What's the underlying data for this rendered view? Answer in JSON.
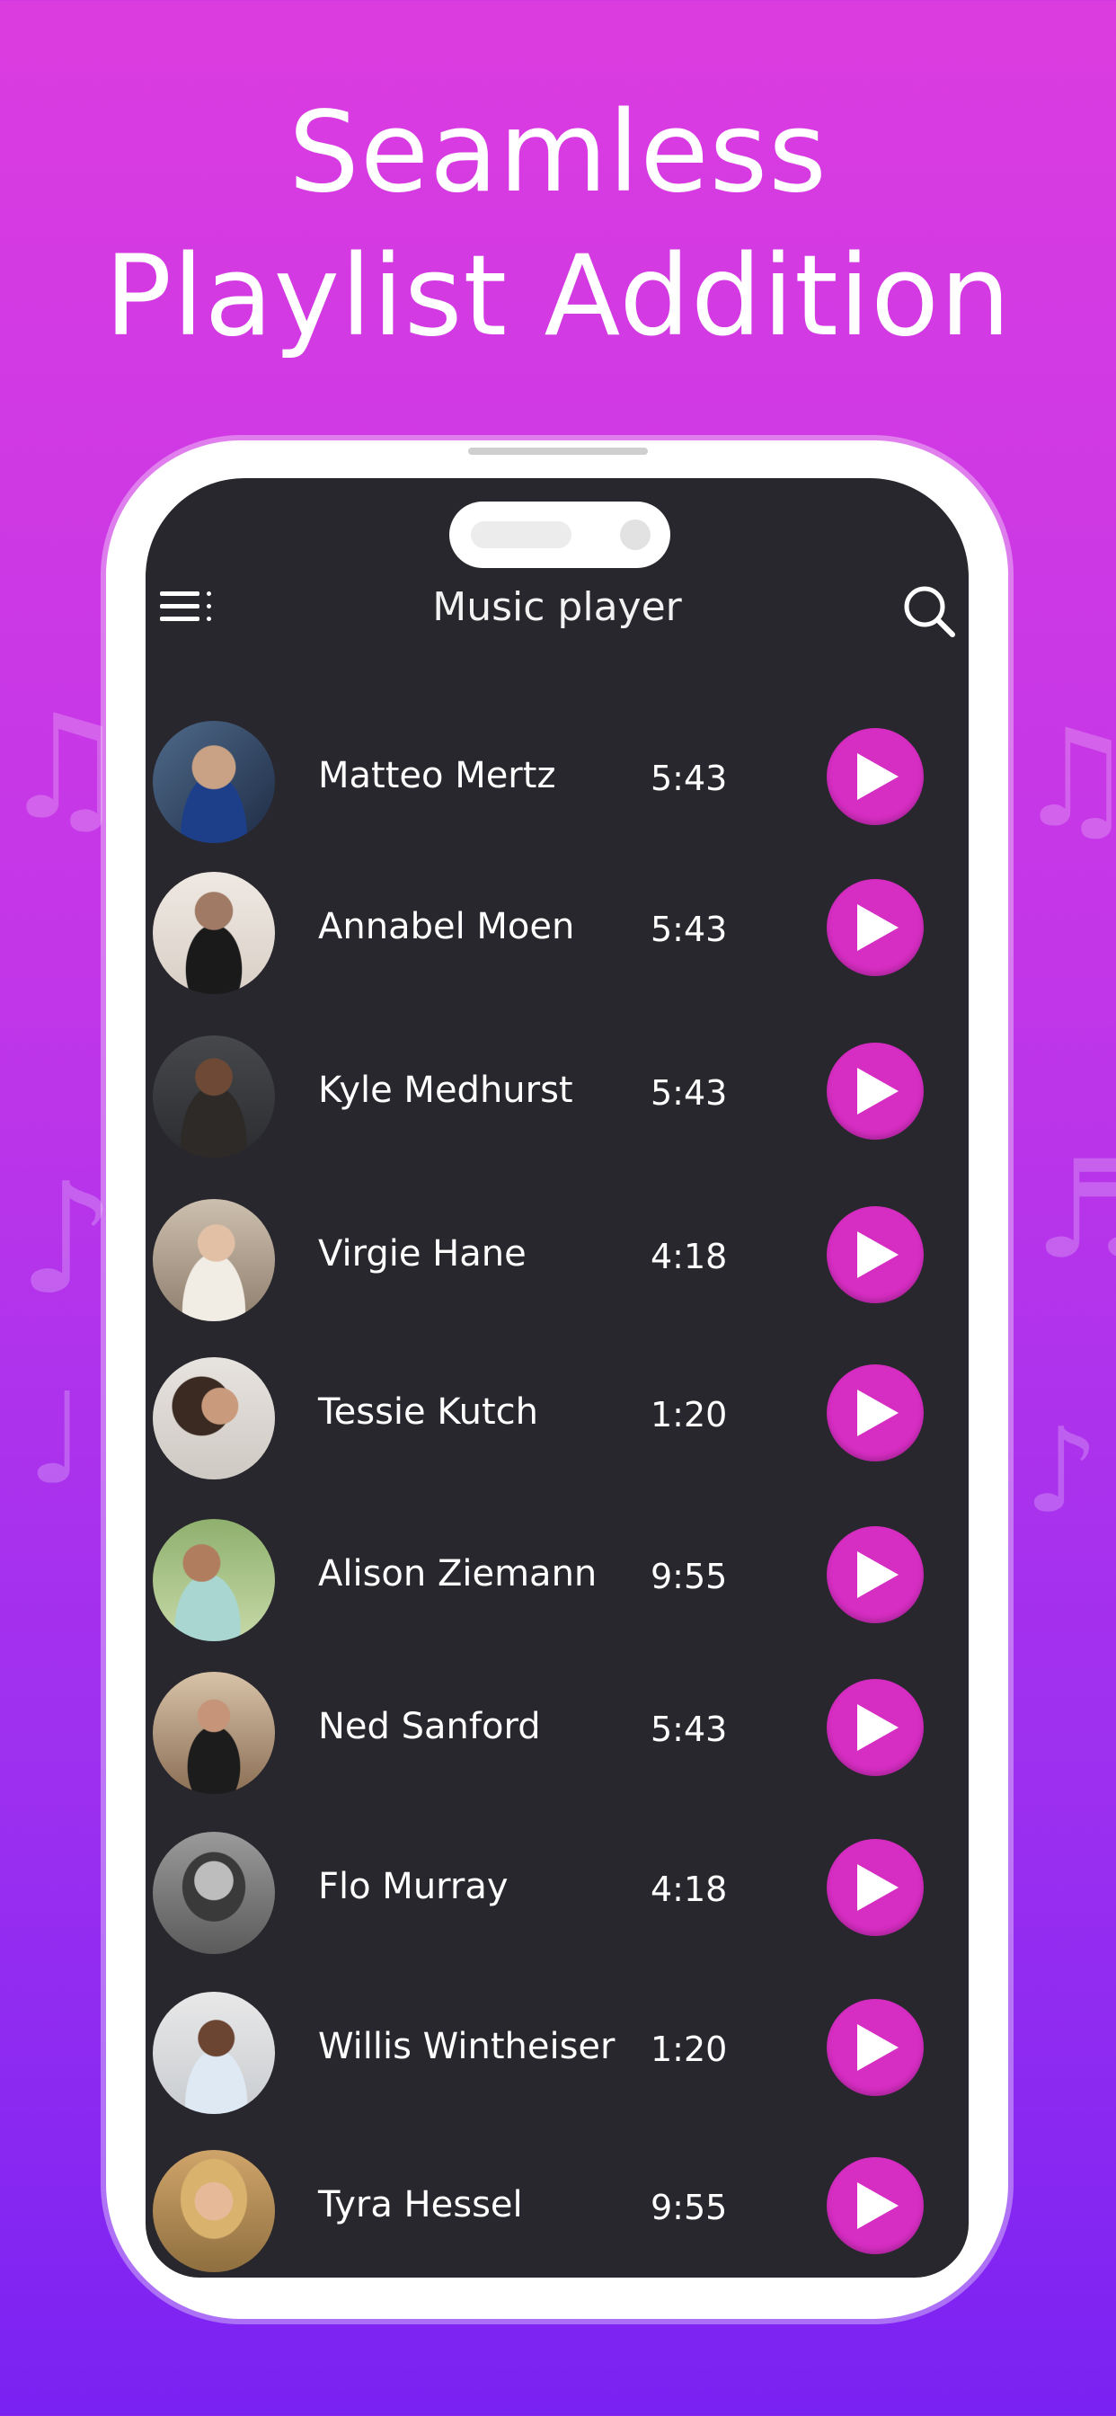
{
  "headline": {
    "line1": "Seamless",
    "line2": "Playlist Addition"
  },
  "app": {
    "title": "Music player"
  },
  "colors": {
    "accent": "#d62dc2",
    "screen_bg": "#28272d",
    "bg_top": "#db3ce0",
    "bg_bottom": "#7a22f2"
  },
  "icons": {
    "menu": "menu-icon",
    "search": "search-icon",
    "play": "play-icon"
  },
  "tracks": [
    {
      "name": "Matteo Mertz",
      "duration": "5:43"
    },
    {
      "name": "Annabel Moen",
      "duration": "5:43"
    },
    {
      "name": "Kyle Medhurst",
      "duration": "5:43"
    },
    {
      "name": "Virgie Hane",
      "duration": "4:18"
    },
    {
      "name": "Tessie Kutch",
      "duration": "1:20"
    },
    {
      "name": "Alison Ziemann",
      "duration": "9:55"
    },
    {
      "name": "Ned Sanford",
      "duration": "5:43"
    },
    {
      "name": "Flo Murray",
      "duration": "4:18"
    },
    {
      "name": "Willis Wintheiser",
      "duration": "1:20"
    },
    {
      "name": "Tyra Hessel",
      "duration": "9:55"
    }
  ]
}
